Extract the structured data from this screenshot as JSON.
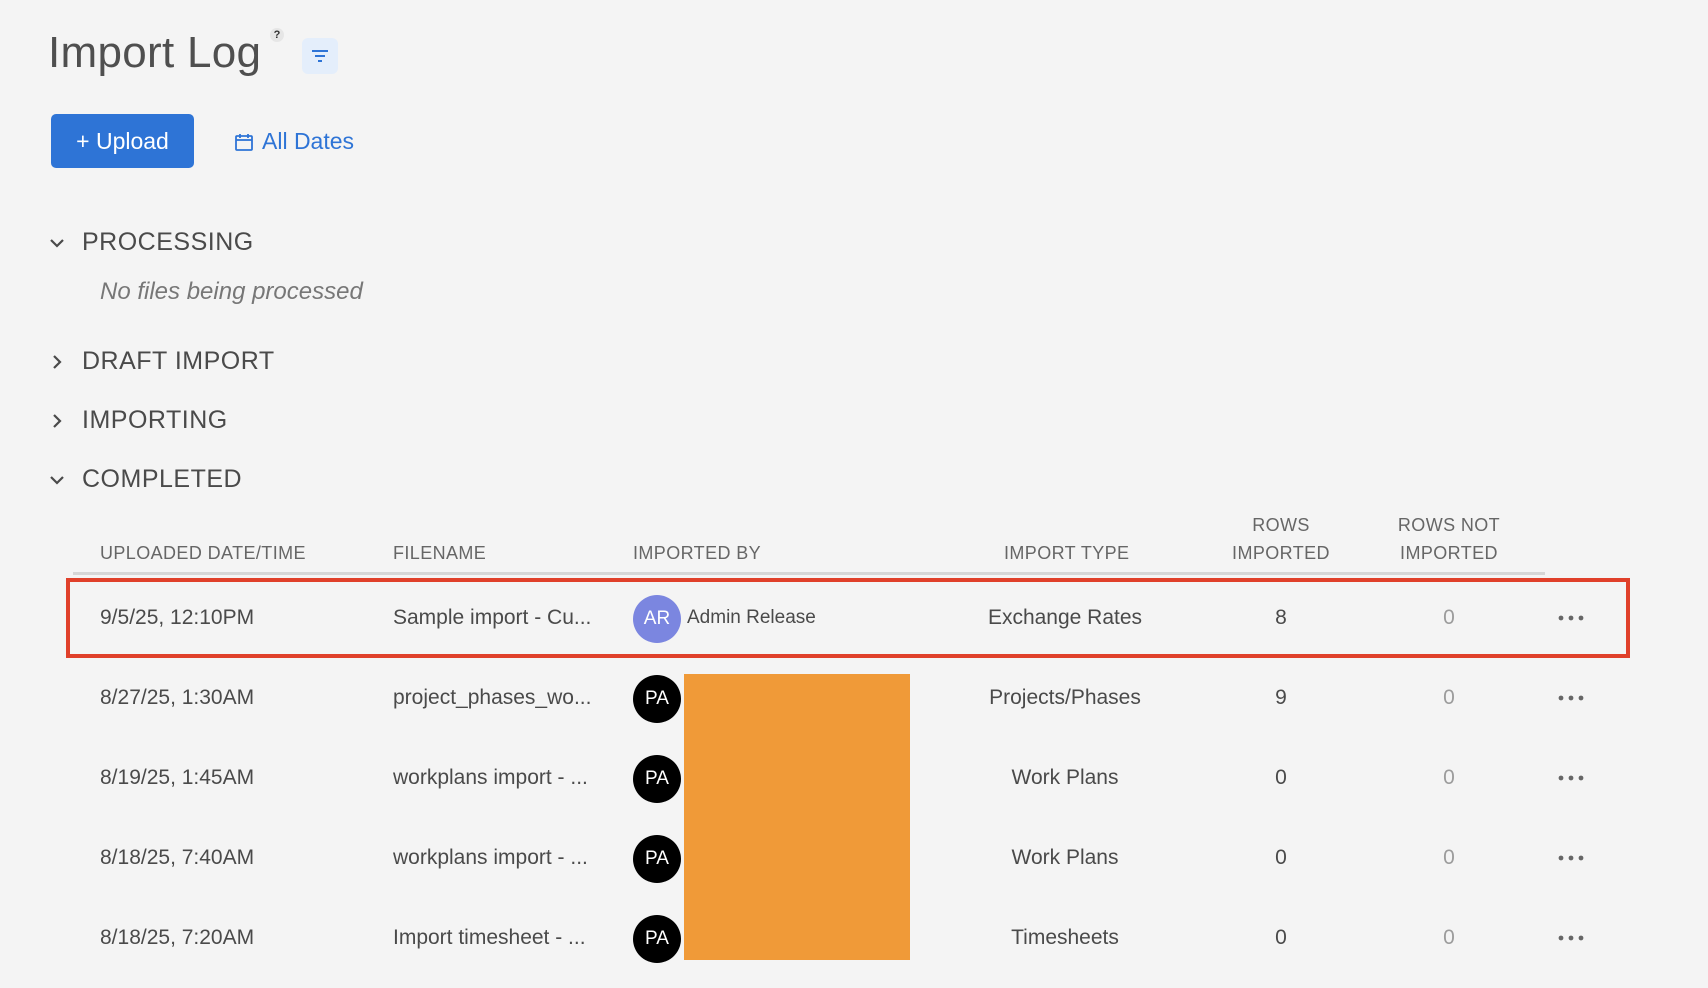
{
  "header": {
    "title": "Import Log",
    "help_icon": "?",
    "filter_icon": "filter-icon"
  },
  "toolbar": {
    "upload_label": "+ Upload",
    "dates_label": "All Dates",
    "dates_icon": "calendar-icon"
  },
  "sections": {
    "processing": {
      "label": "PROCESSING",
      "expanded": true,
      "empty_note": "No files being processed"
    },
    "draft": {
      "label": "DRAFT IMPORT",
      "expanded": false
    },
    "importing": {
      "label": "IMPORTING",
      "expanded": false
    },
    "completed": {
      "label": "COMPLETED",
      "expanded": true
    }
  },
  "table": {
    "columns": {
      "uploaded": "UPLOADED DATE/TIME",
      "filename": "FILENAME",
      "imported_by": "IMPORTED BY",
      "import_type": "IMPORT TYPE",
      "rows_imported_1": "ROWS",
      "rows_imported_2": "IMPORTED",
      "rows_not_1": "ROWS NOT",
      "rows_not_2": "IMPORTED"
    },
    "rows": [
      {
        "uploaded": "9/5/25, 12:10PM",
        "filename": "Sample import - Cu...",
        "initials": "AR",
        "user": "Admin Release",
        "avatar_color": "#7b86e0",
        "import_type": "Exchange Rates",
        "rows_imported": "8",
        "rows_not": "0",
        "highlighted": true
      },
      {
        "uploaded": "8/27/25, 1:30AM",
        "filename": "project_phases_wo...",
        "initials": "PA",
        "user": "",
        "avatar_color": "#000000",
        "import_type": "Projects/Phases",
        "rows_imported": "9",
        "rows_not": "0"
      },
      {
        "uploaded": "8/19/25, 1:45AM",
        "filename": "workplans import - ...",
        "initials": "PA",
        "user": "",
        "avatar_color": "#000000",
        "import_type": "Work Plans",
        "rows_imported": "0",
        "rows_not": "0"
      },
      {
        "uploaded": "8/18/25, 7:40AM",
        "filename": "workplans import - ...",
        "initials": "PA",
        "user": "",
        "avatar_color": "#000000",
        "import_type": "Work Plans",
        "rows_imported": "0",
        "rows_not": "0"
      },
      {
        "uploaded": "8/18/25, 7:20AM",
        "filename": "Import timesheet - ...",
        "initials": "PA",
        "user": "",
        "avatar_color": "#000000",
        "import_type": "Timesheets",
        "rows_imported": "0",
        "rows_not": "0"
      }
    ]
  },
  "colors": {
    "accent": "#2e74d6",
    "highlight": "#e0402a",
    "redaction": "#f09a38"
  }
}
